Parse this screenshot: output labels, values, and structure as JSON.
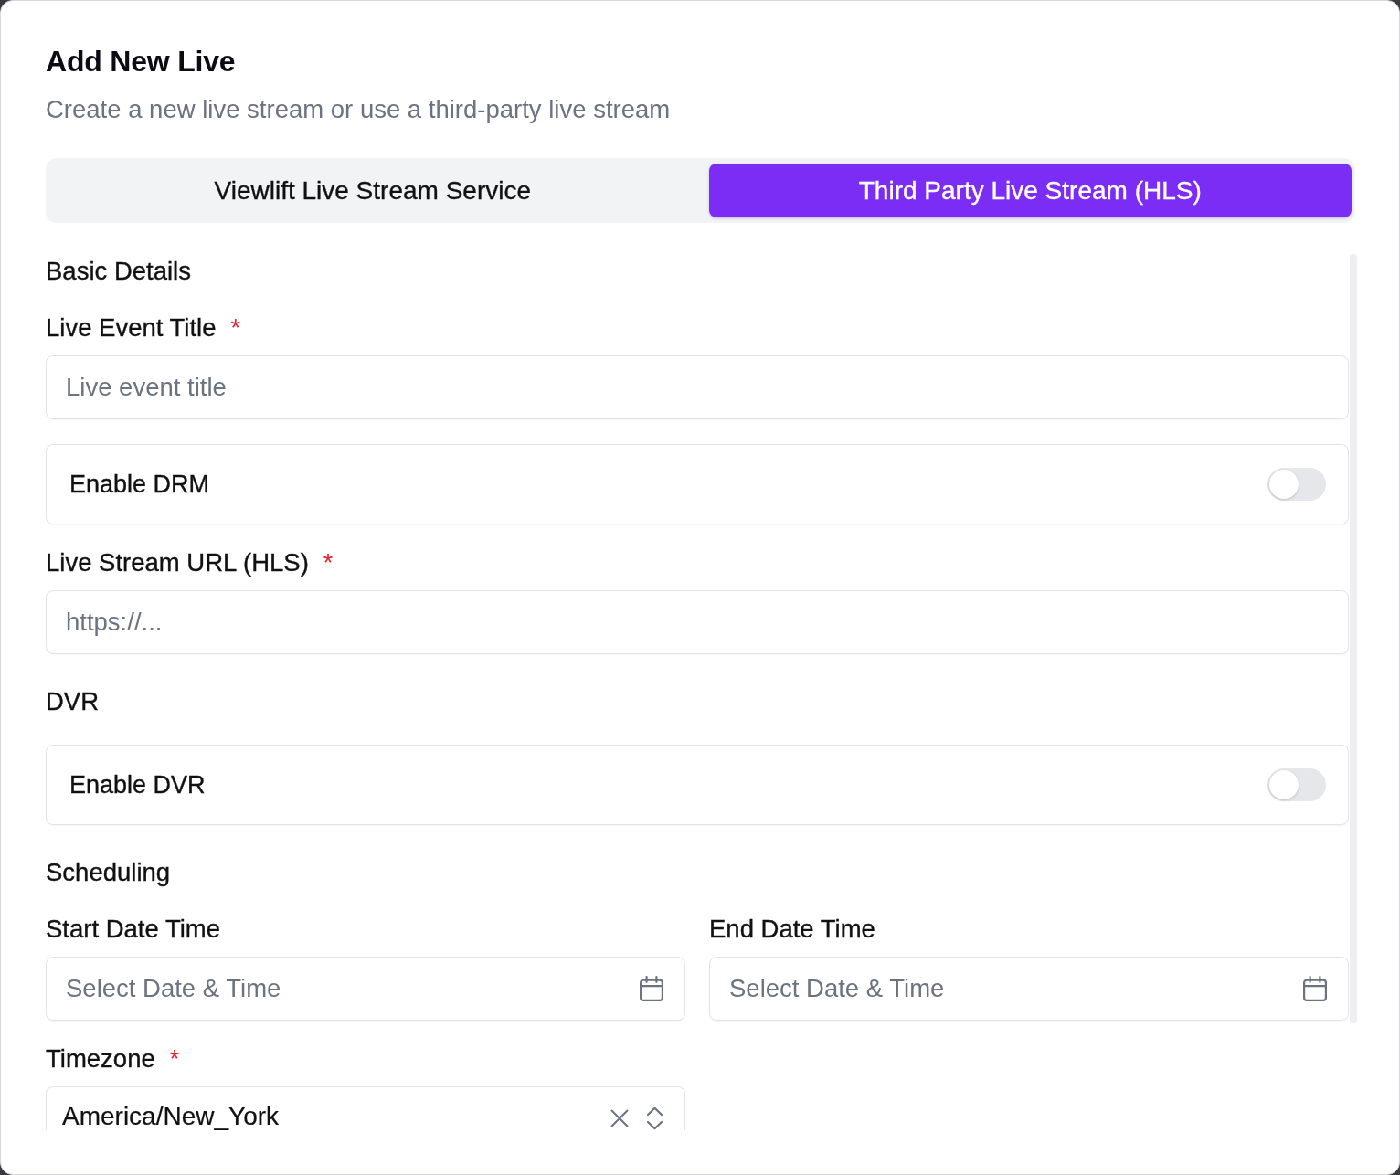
{
  "dialog": {
    "title": "Add New Live",
    "subtitle": "Create a new live stream or use a third-party live stream"
  },
  "tabs": [
    {
      "label": "Viewlift Live Stream Service",
      "selected": false
    },
    {
      "label": "Third Party Live Stream (HLS)",
      "selected": true
    }
  ],
  "form": {
    "sections": [
      {
        "heading": "Basic Details",
        "fields": [
          {
            "kind": "text",
            "label": "Live Event Title",
            "required_mark": "*",
            "placeholder": "Live event title"
          },
          {
            "kind": "toggle",
            "label": "Enable DRM",
            "on": false
          },
          {
            "kind": "text",
            "label": "Live Stream URL (HLS)",
            "required_mark": "*",
            "placeholder": "https://..."
          }
        ]
      },
      {
        "heading": "DVR",
        "fields": [
          {
            "kind": "toggle",
            "label": "Enable DVR",
            "on": false
          }
        ]
      },
      {
        "heading": "Scheduling",
        "fields": [
          {
            "kind": "date",
            "label": "Start Date Time",
            "placeholder": "Select Date & Time"
          },
          {
            "kind": "date",
            "label": "End Date Time",
            "placeholder": "Select Date & Time"
          },
          {
            "kind": "select",
            "label": "Timezone",
            "required_mark": "*",
            "value": "America/New_York"
          }
        ]
      }
    ]
  }
}
